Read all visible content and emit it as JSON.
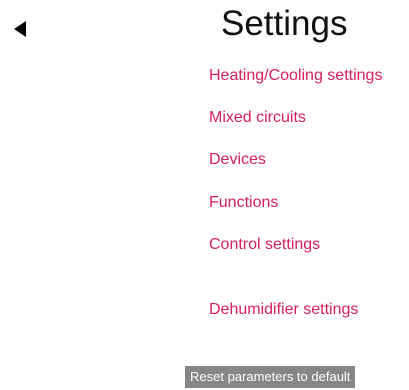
{
  "header": {
    "title": "Settings",
    "back_icon": "back-triangle-icon"
  },
  "menu": {
    "items": [
      {
        "label": "Heating/Cooling settings"
      },
      {
        "label": "Mixed circuits"
      },
      {
        "label": "Devices"
      },
      {
        "label": "Functions"
      },
      {
        "label": "Control settings"
      },
      {
        "label": "Dehumidifier settings"
      }
    ]
  },
  "footer": {
    "reset_label": "Reset parameters to default"
  },
  "colors": {
    "link": "#d5205a",
    "button_bg": "#868686",
    "title": "#111111"
  }
}
